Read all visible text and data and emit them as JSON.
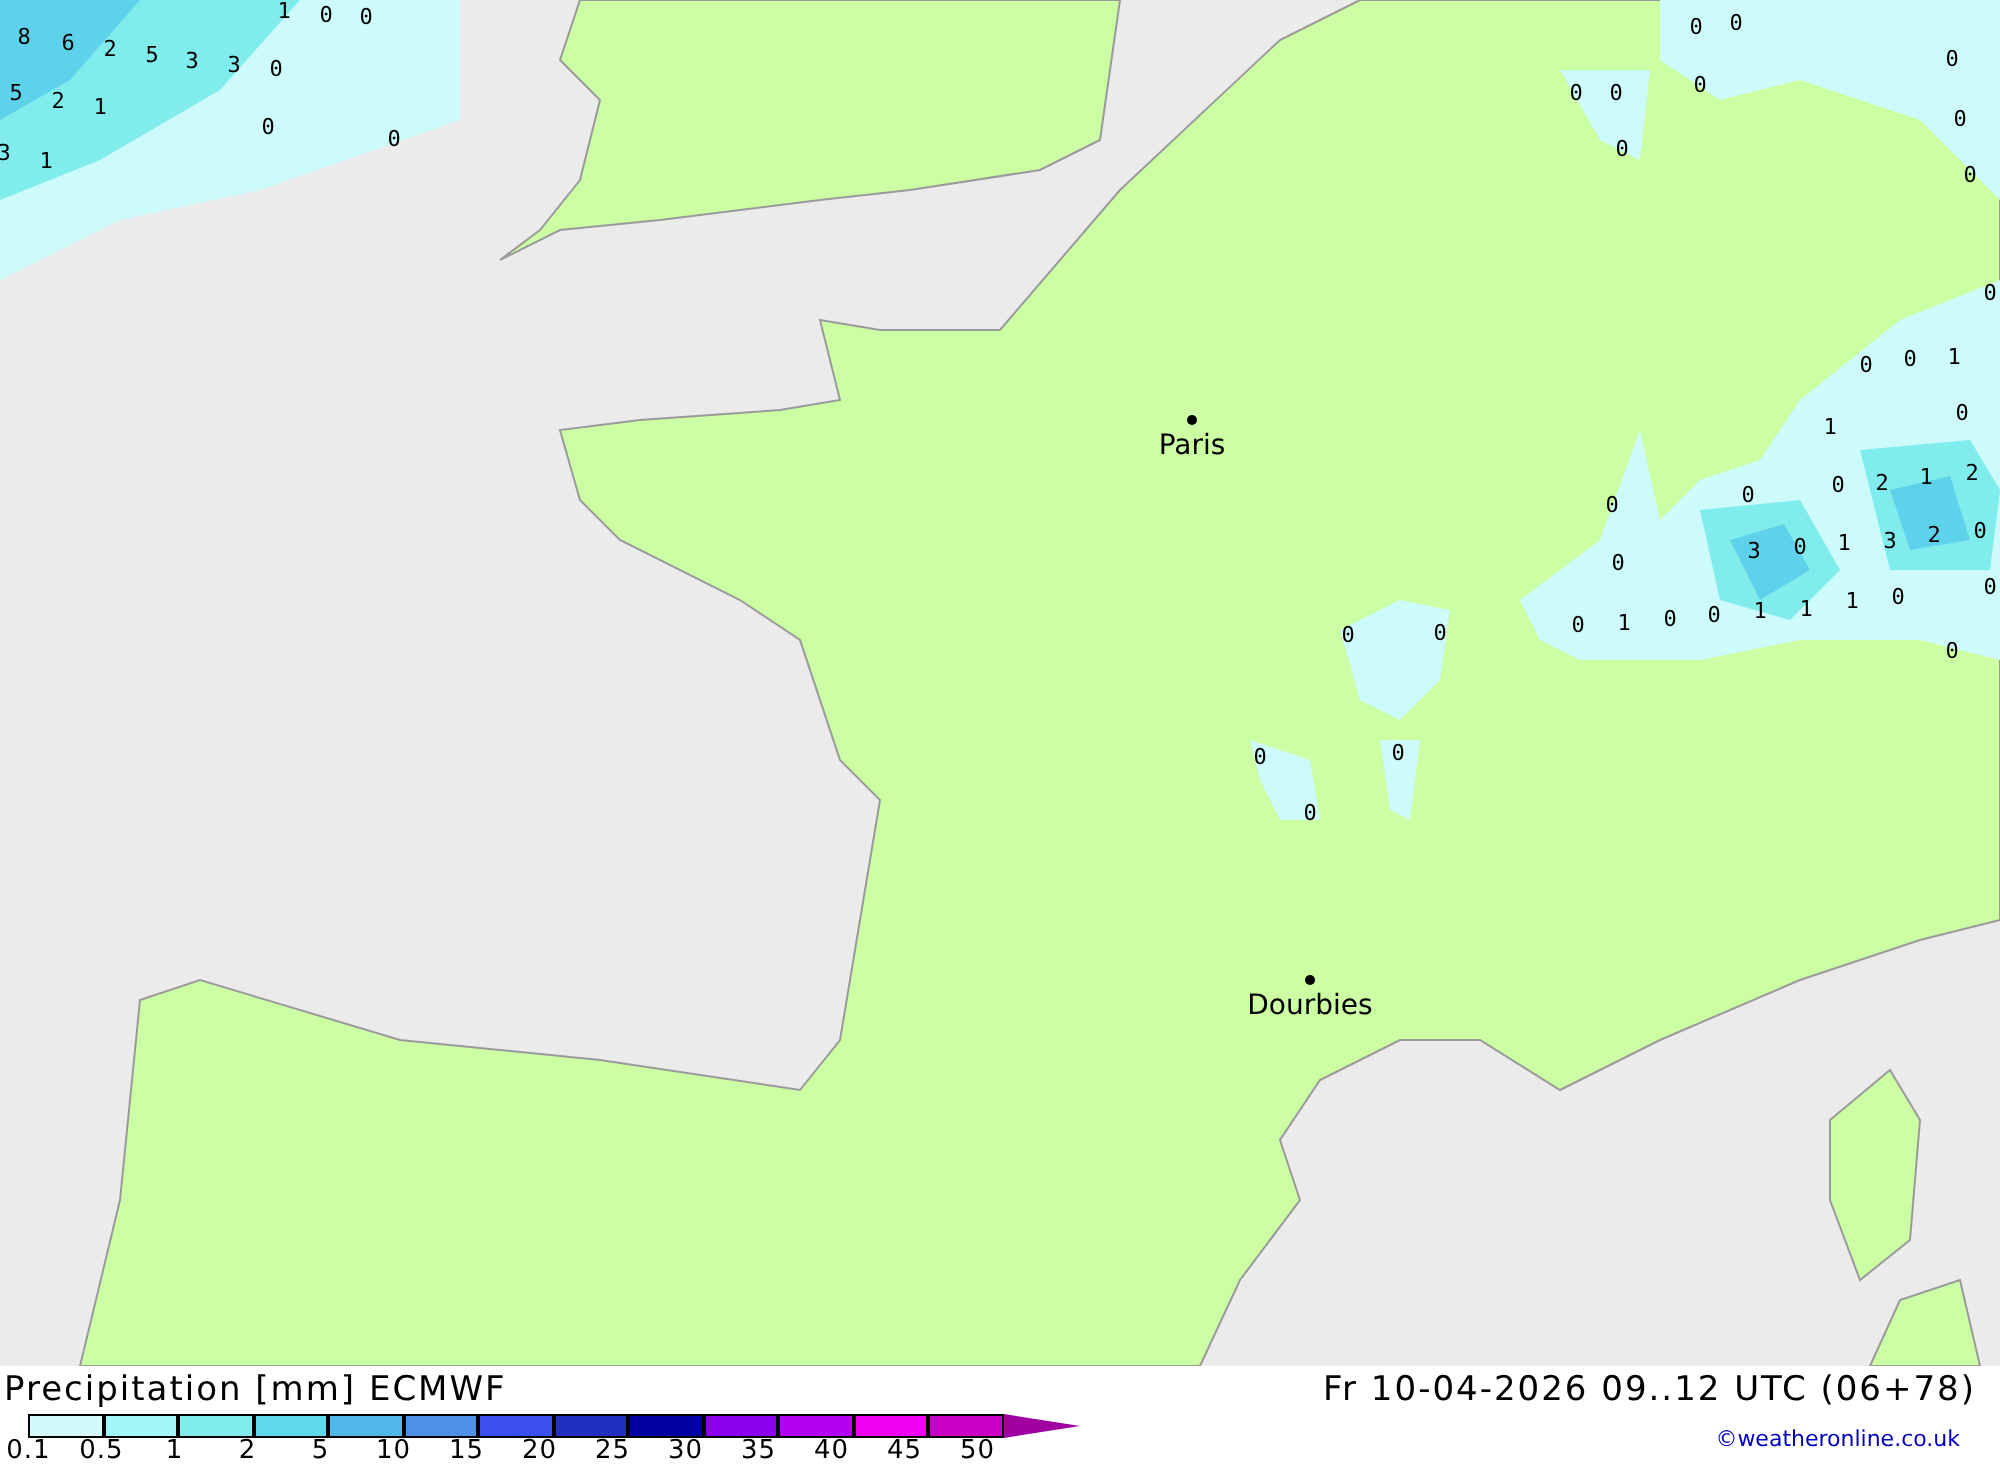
{
  "map": {
    "cities": [
      {
        "name": "Paris"
      },
      {
        "name": "Dourbies"
      }
    ],
    "values": [
      "8",
      "6",
      "2",
      "5",
      "3",
      "3",
      "0",
      "5",
      "2",
      "1",
      "3",
      "1",
      "0",
      "0",
      "1",
      "0",
      "0",
      "0",
      "0",
      "0",
      "0",
      "0",
      "0",
      "0",
      "0",
      "0",
      "0",
      "0",
      "0",
      "1",
      "0",
      "1",
      "0",
      "0",
      "0",
      "2",
      "1",
      "2",
      "3",
      "0",
      "1",
      "3",
      "2",
      "0",
      "0",
      "0",
      "0",
      "1",
      "0",
      "0",
      "1",
      "1",
      "1",
      "0",
      "0",
      "0",
      "0",
      "0",
      "0",
      "0"
    ]
  },
  "footer": {
    "title": "Precipitation [mm] ECMWF",
    "date": "Fr 10-04-2026 09..12 UTC (06+78)",
    "credit": "©weatheronline.co.uk"
  },
  "legend": {
    "cells": [
      {
        "color": "#d2fafa"
      },
      {
        "color": "#a0f6f8"
      },
      {
        "color": "#80ecec"
      },
      {
        "color": "#5edaea"
      },
      {
        "color": "#50b8e8"
      },
      {
        "color": "#5090e6"
      },
      {
        "color": "#3c50f0"
      },
      {
        "color": "#2030c0"
      },
      {
        "color": "#0000a0"
      },
      {
        "color": "#8c00f0"
      },
      {
        "color": "#b400f0"
      },
      {
        "color": "#f000f0"
      },
      {
        "color": "#c800c8"
      }
    ],
    "arrow": {
      "color": "#a000a0"
    },
    "labels": [
      "0.1",
      "0.5",
      "1",
      "2",
      "5",
      "10",
      "15",
      "20",
      "25",
      "30",
      "35",
      "40",
      "45",
      "50"
    ]
  }
}
